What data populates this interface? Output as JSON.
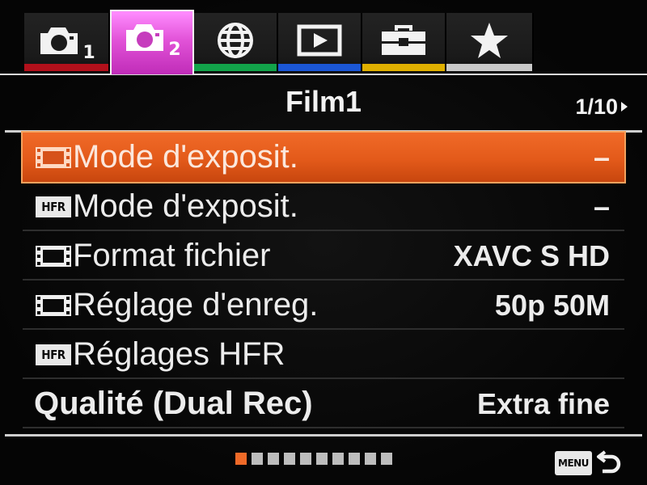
{
  "tabs": [
    {
      "icon": "camera-icon",
      "number": "1",
      "color": "#b2101b",
      "active": false
    },
    {
      "icon": "camera-icon",
      "number": "2",
      "color": "#d43bd0",
      "active": true
    },
    {
      "icon": "globe-icon",
      "number": "",
      "color": "#12a34a",
      "active": false
    },
    {
      "icon": "playback-icon",
      "number": "",
      "color": "#1b57d6",
      "active": false
    },
    {
      "icon": "toolbox-icon",
      "number": "",
      "color": "#e0b000",
      "active": false
    },
    {
      "icon": "star-icon",
      "number": "",
      "color": "#c9c9c9",
      "active": false
    }
  ],
  "header": {
    "title": "Film1",
    "page": "1/10"
  },
  "menu": {
    "items": [
      {
        "icon": "film-icon",
        "label": "Mode d'exposit.",
        "value": "–",
        "selected": true
      },
      {
        "icon": "hfr-icon",
        "label": "Mode d'exposit.",
        "value": "–",
        "selected": false
      },
      {
        "icon": "film-icon",
        "label": "Format fichier",
        "value": "XAVC S HD",
        "selected": false
      },
      {
        "icon": "film-icon",
        "label": "Réglage d'enreg.",
        "value": "50p 50M",
        "selected": false
      },
      {
        "icon": "hfr-icon",
        "label": "Réglages HFR",
        "value": "",
        "selected": false
      },
      {
        "icon": "",
        "label": "Qualité (Dual Rec)",
        "value": "Extra fine",
        "selected": false
      }
    ]
  },
  "icons": {
    "hfr_text": "HFR"
  },
  "pagination": {
    "total": 10,
    "current": 1,
    "active_color": "#f06a28"
  },
  "footer": {
    "menu_label": "MENU",
    "back_icon": "return-arrow-icon"
  },
  "colors": {
    "selection": "#e35a1a",
    "background": "#060606"
  }
}
